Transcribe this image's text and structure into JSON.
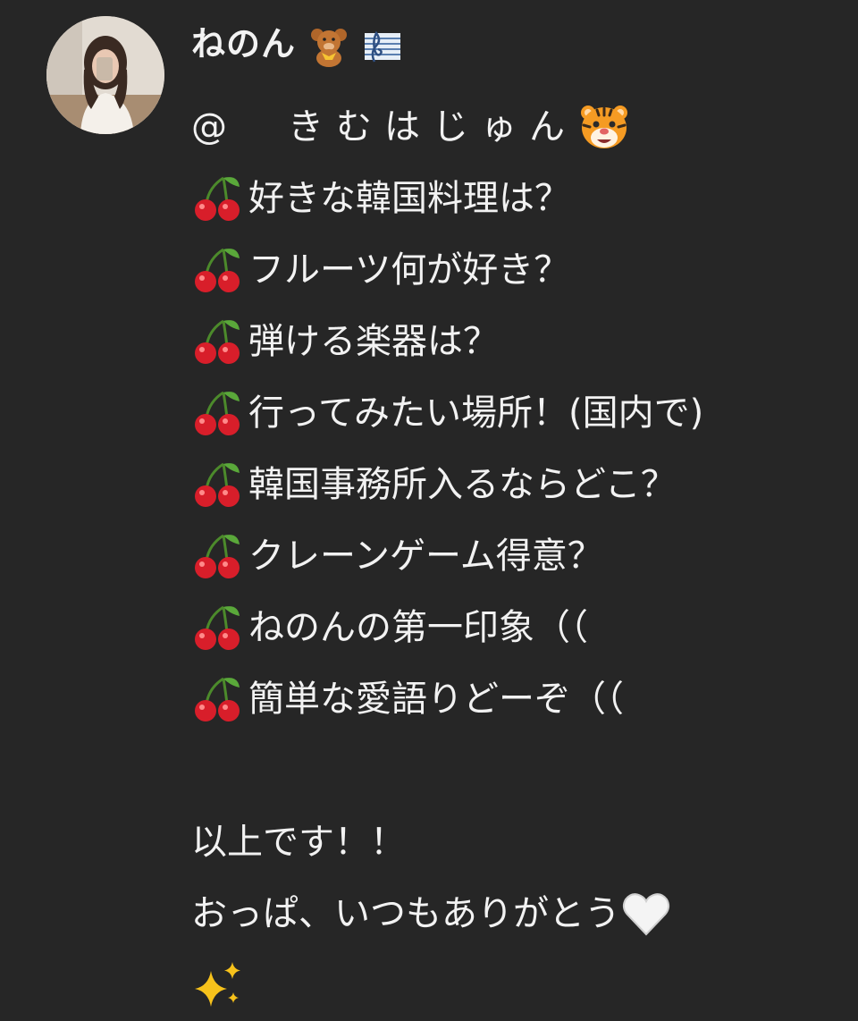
{
  "sender": {
    "name": "ねのん",
    "name_emojis": [
      "teddy-bear",
      "musical-score"
    ]
  },
  "message": {
    "mention": "@　きむはじゅん",
    "mention_emoji": "tiger-face",
    "question_bullet_emoji": "cherries",
    "questions": [
      "好きな韓国料理は？",
      "フルーツ何が好き？",
      "弾ける楽器は？",
      "行ってみたい場所！(国内で)",
      "韓国事務所入るならどこ？",
      "クレーンゲーム得意？",
      "ねのんの第一印象（（",
      "簡単な愛語りどーぞ（（"
    ],
    "closing_line_1": "以上です！！",
    "closing_line_2": "おっぱ、いつもありがとう",
    "closing_line_2_emoji": "white-heart",
    "final_emoji": "sparkles"
  },
  "colors": {
    "background": "#262626",
    "text": "#f2f2f2"
  }
}
